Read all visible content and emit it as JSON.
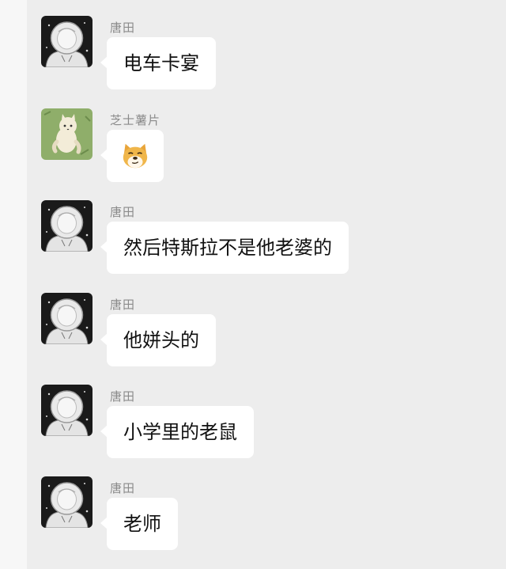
{
  "messages": [
    {
      "sender": "唐田",
      "text": "电车卡宴",
      "avatar": "astronaut-sketch-avatar"
    },
    {
      "sender": "芝士薯片",
      "text": "",
      "emoji": "doge-face-emoji",
      "avatar": "cat-on-green-avatar"
    },
    {
      "sender": "唐田",
      "text": "然后特斯拉不是他老婆的",
      "avatar": "astronaut-sketch-avatar"
    },
    {
      "sender": "唐田",
      "text": "他姘头的",
      "avatar": "astronaut-sketch-avatar"
    },
    {
      "sender": "唐田",
      "text": "小学里的老鼠",
      "avatar": "astronaut-sketch-avatar"
    },
    {
      "sender": "唐田",
      "text": "老师",
      "avatar": "astronaut-sketch-avatar"
    }
  ],
  "colors": {
    "background": "#ededed",
    "bubble": "#ffffff",
    "sender_name": "#8a8a8a",
    "cat_avatar_bg": "#8fae6a"
  }
}
